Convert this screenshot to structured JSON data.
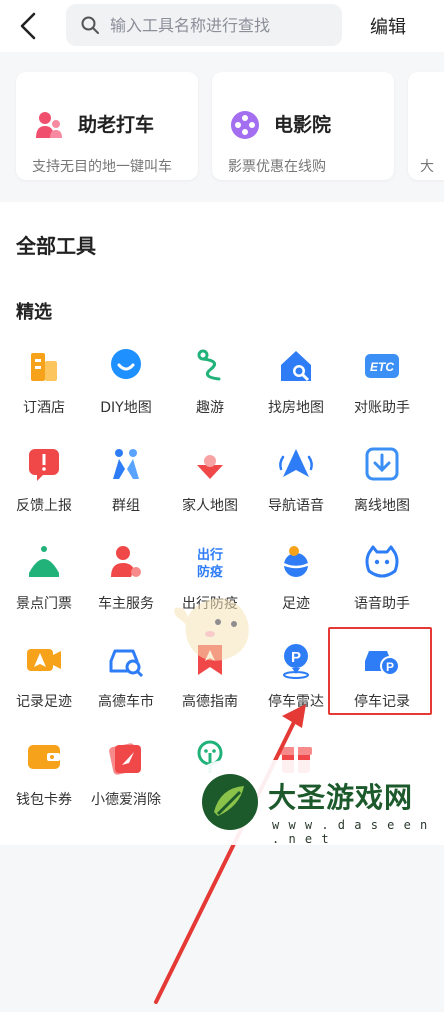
{
  "header": {
    "search_placeholder": "输入工具名称进行查找",
    "edit_label": "编辑"
  },
  "recent_cards": [
    {
      "title": "助老打车",
      "subtitle": "支持无目的地一键叫车",
      "icon": "elder-person-icon",
      "color": "#f0506e"
    },
    {
      "title": "电影院",
      "subtitle": "影票优惠在线购",
      "icon": "film-reel-icon",
      "color": "#a36ef0"
    },
    {
      "title": "",
      "subtitle": "大",
      "icon": "",
      "color": "#cccccc"
    }
  ],
  "sections": {
    "all_tools": "全部工具",
    "featured": "精选"
  },
  "tools": [
    {
      "label": "订酒店",
      "icon": "hotel-icon",
      "color": "#f7a21b"
    },
    {
      "label": "DIY地图",
      "icon": "map-pin-smile-icon",
      "color": "#1e90ff"
    },
    {
      "label": "趣游",
      "icon": "fun-trip-icon",
      "color": "#21b27a"
    },
    {
      "label": "找房地图",
      "icon": "house-search-icon",
      "color": "#2e7df6"
    },
    {
      "label": "对账助手",
      "icon": "etc-icon",
      "color": "#3b8ff5"
    },
    {
      "label": "反馈上报",
      "icon": "alert-icon",
      "color": "#f04848"
    },
    {
      "label": "群组",
      "icon": "group-people-icon",
      "color": "#2e7df6"
    },
    {
      "label": "家人地图",
      "icon": "family-map-icon",
      "color": "#f04848"
    },
    {
      "label": "导航语音",
      "icon": "navigation-arrow-icon",
      "color": "#2e7df6"
    },
    {
      "label": "离线地图",
      "icon": "download-map-icon",
      "color": "#3b8ff5"
    },
    {
      "label": "景点门票",
      "icon": "scenic-ticket-icon",
      "color": "#21b27a"
    },
    {
      "label": "车主服务",
      "icon": "car-owner-icon",
      "color": "#f04848"
    },
    {
      "label": "出行防疫",
      "icon": "travel-epidemic-icon",
      "color": "#2e7df6"
    },
    {
      "label": "足迹",
      "icon": "footprint-globe-icon",
      "color": "#2e7df6"
    },
    {
      "label": "语音助手",
      "icon": "voice-assistant-icon",
      "color": "#2e7df6"
    },
    {
      "label": "记录足迹",
      "icon": "record-footprint-icon",
      "color": "#f7a21b"
    },
    {
      "label": "高德车市",
      "icon": "car-market-icon",
      "color": "#2e7df6"
    },
    {
      "label": "高德指南",
      "icon": "guide-bookmark-icon",
      "color": "#f04848"
    },
    {
      "label": "停车雷达",
      "icon": "parking-radar-icon",
      "color": "#2e7df6"
    },
    {
      "label": "停车记录",
      "icon": "parking-record-icon",
      "color": "#2e7df6"
    },
    {
      "label": "钱包卡券",
      "icon": "wallet-icon",
      "color": "#f7a21b"
    },
    {
      "label": "小德爱消除",
      "icon": "game-card-icon",
      "color": "#f04848"
    },
    {
      "label": "",
      "icon": "tree-icon",
      "color": "#21b27a"
    },
    {
      "label": "",
      "icon": "gift-box-icon",
      "color": "#f04848"
    }
  ],
  "watermark": {
    "title": "大圣游戏网",
    "url": "w w w . d a s e e n . n e t"
  }
}
